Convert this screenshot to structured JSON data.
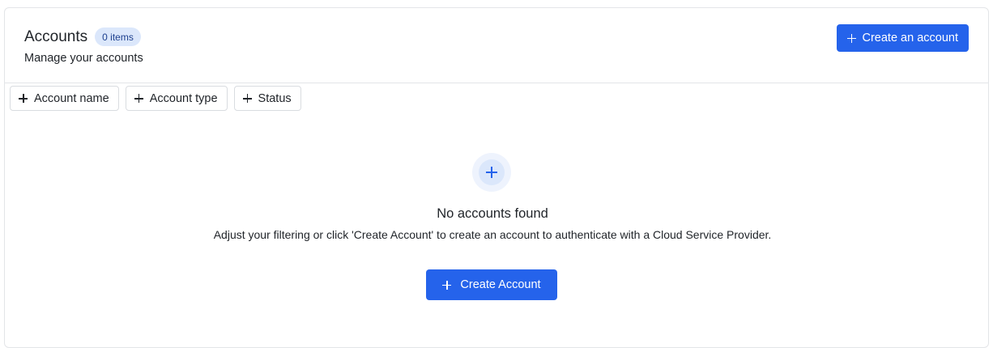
{
  "header": {
    "title": "Accounts",
    "badge": "0 items",
    "subtitle": "Manage your accounts",
    "create_button_label": "Create an account",
    "create_button_icon": "plus-icon"
  },
  "filters": [
    {
      "label": "Account name",
      "icon": "plus-icon"
    },
    {
      "label": "Account type",
      "icon": "plus-icon"
    },
    {
      "label": "Status",
      "icon": "plus-icon"
    }
  ],
  "empty_state": {
    "icon": "plus-icon",
    "title": "No accounts found",
    "description": "Adjust your filtering or click 'Create Account' to create an account to authenticate with a Cloud Service Provider.",
    "cta_label": "Create Account"
  },
  "colors": {
    "primary": "#2563eb",
    "badge_bg": "#dbe7fb",
    "border": "#e3e5e8"
  }
}
